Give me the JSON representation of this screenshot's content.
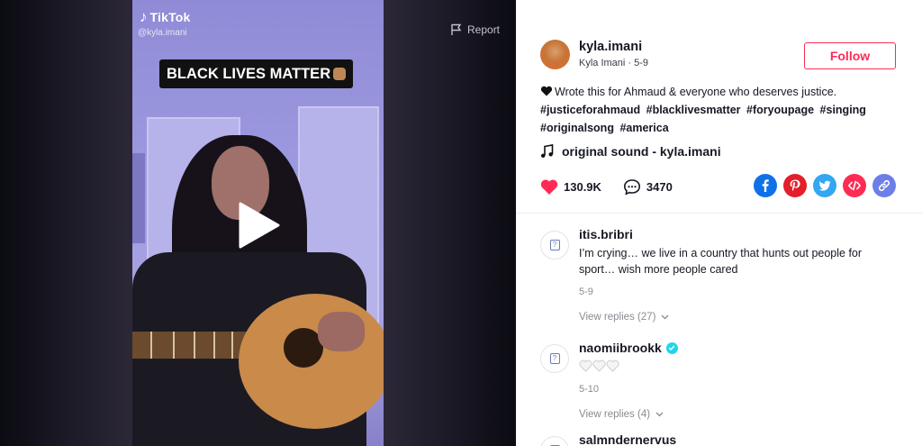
{
  "video": {
    "brand": "TikTok",
    "handle": "@kyla.imani",
    "caption": "BLACK LIVES MATTER",
    "caption_emoji": "fist-icon",
    "report_label": "Report"
  },
  "author": {
    "username": "kyla.imani",
    "meta": "Kyla Imani · 5-9",
    "follow_label": "Follow"
  },
  "description": {
    "emoji": "black-heart-icon",
    "text": "Wrote this for Ahmaud & everyone who deserves justice.",
    "hashtags": [
      "#justiceforahmaud",
      "#blacklivesmatter",
      "#foryoupage",
      "#singing",
      "#originalsong",
      "#america"
    ]
  },
  "music": {
    "label": "original sound - kyla.imani"
  },
  "stats": {
    "likes": "130.9K",
    "comments": "3470"
  },
  "share": [
    {
      "name": "facebook",
      "color": "#0f71e8"
    },
    {
      "name": "pinterest",
      "color": "#e21f2b"
    },
    {
      "name": "twitter",
      "color": "#34a6f2"
    },
    {
      "name": "embed",
      "color": "#fe2c55"
    },
    {
      "name": "copy-link",
      "color": "#6d7ee8"
    }
  ],
  "comments": [
    {
      "user": "itis.bribri",
      "verified": false,
      "text": "I’m crying… we live in a country that hunts out people for sport… wish more people cared",
      "date": "5-9",
      "replies": "View replies (27)"
    },
    {
      "user": "naomiibrookk",
      "verified": true,
      "text": "",
      "emoji": "white-hearts-icon",
      "date": "5-10",
      "replies": "View replies (4)"
    },
    {
      "user": "salmndernervus",
      "verified": false,
      "text": "",
      "date": "",
      "replies": ""
    }
  ],
  "colors": {
    "accent": "#fe2c55",
    "verified": "#20d5ec",
    "muted": "#8a8b91"
  }
}
